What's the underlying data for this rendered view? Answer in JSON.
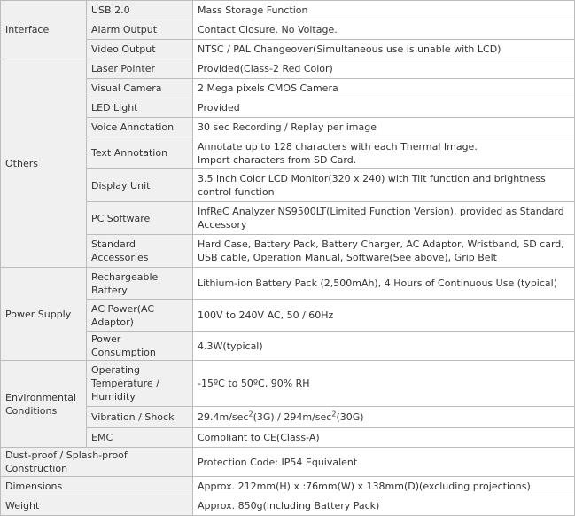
{
  "rows": [
    {
      "cat": "Interface",
      "sub": "USB 2.0",
      "val": "Mass Storage Function"
    },
    {
      "sub": "Alarm Output",
      "val": "Contact Closure. No Voltage."
    },
    {
      "sub": "Video Output",
      "val": "NTSC / PAL Changeover(Simultaneous use is unable with LCD)"
    },
    {
      "cat": "Others",
      "sub": "Laser Pointer",
      "val": "Provided(Class-2 Red Color)"
    },
    {
      "sub": "Visual Camera",
      "val": "2 Mega pixels CMOS Camera"
    },
    {
      "sub": "LED Light",
      "val": "Provided"
    },
    {
      "sub": "Voice Annotation",
      "val": "30 sec Recording / Replay per image"
    },
    {
      "sub": "Text Annotation",
      "val_line1": "Annotate up to 128 characters with each Thermal Image.",
      "val_line2": "Import characters from SD Card."
    },
    {
      "sub": "Display Unit",
      "val": "3.5 inch Color LCD Monitor(320 x 240) with Tilt function and brightness control function"
    },
    {
      "sub": "PC Software",
      "val": "InfReC Analyzer NS9500LT(Limited Function Version), provided as Standard Accessory"
    },
    {
      "sub": "Standard Accessories",
      "val": "Hard Case, Battery Pack, Battery Charger, AC Adaptor, Wristband, SD card, USB cable, Operation Manual, Software(See above), Grip Belt"
    },
    {
      "cat": "Power Supply",
      "sub": "Rechargeable Battery",
      "val": "Lithium-ion Battery Pack (2,500mAh), 4 Hours of Continuous Use (typical)"
    },
    {
      "sub": "AC Power(AC Adaptor)",
      "val": "100V to 240V AC, 50 / 60Hz"
    },
    {
      "sub": "Power Consumption",
      "val": "4.3W(typical)"
    },
    {
      "cat": "Environmental Conditions",
      "sub": "Operating Temperature / Humidity",
      "val": "-15ºC to 50ºC, 90% RH"
    },
    {
      "sub": "Vibration / Shock",
      "val_a": "29.4m/sec",
      "sup_a": "2",
      "val_b": "(3G) / 294m/sec",
      "sup_b": "2",
      "val_c": "(30G)"
    },
    {
      "sub": "EMC",
      "val": "Compliant to CE(Class-A)"
    },
    {
      "cat": "Dust-proof / Splash-proof Construction",
      "val": "Protection Code: IP54 Equivalent"
    },
    {
      "cat": "Dimensions",
      "val": "Approx. 212mm(H) x :76mm(W) x 138mm(D)(excluding projections)"
    },
    {
      "cat": "Weight",
      "val": "Approx. 850g(including Battery Pack)"
    }
  ]
}
